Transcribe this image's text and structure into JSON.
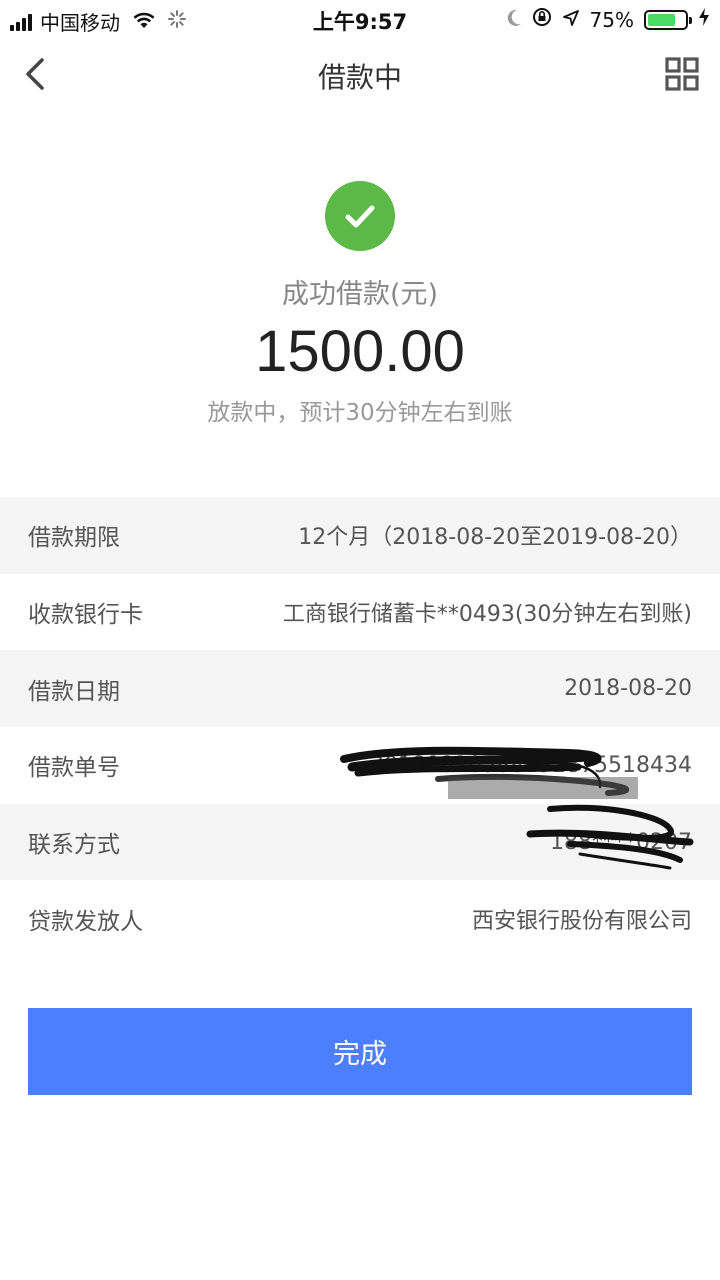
{
  "status_bar": {
    "carrier": "中国移动",
    "time": "上午9:57",
    "battery": "75%",
    "battery_level": 0.75,
    "icons": [
      "signal-icon",
      "wifi-icon",
      "loading-icon",
      "moon-icon",
      "orientation-lock-icon",
      "location-icon",
      "battery-icon",
      "charging-icon"
    ]
  },
  "nav": {
    "title": "借款中",
    "back_icon": "chevron-left-icon",
    "menu_icon": "grid-icon"
  },
  "result": {
    "icon": "check-icon",
    "label": "成功借款(元)",
    "amount": "1500.00",
    "note": "放款中，预计30分钟左右到账"
  },
  "details": [
    {
      "label": "借款期限",
      "value": "12个月（2018-08-20至2019-08-20）"
    },
    {
      "label": "收款银行卡",
      "value": "工商银行储蓄卡**0493(30分钟左右到账)"
    },
    {
      "label": "借款日期",
      "value": "2018-08-20"
    },
    {
      "label": "借款单号",
      "value": "2018082058819287551843​4"
    },
    {
      "label": "联系方式",
      "value": "188****0207"
    },
    {
      "label": "贷款发放人",
      "value": "西安银行股份有限公司"
    }
  ],
  "actions": {
    "done_label": "完成"
  },
  "colors": {
    "accent": "#4d7efc",
    "success": "#5cb947",
    "battery": "#4cd964"
  }
}
